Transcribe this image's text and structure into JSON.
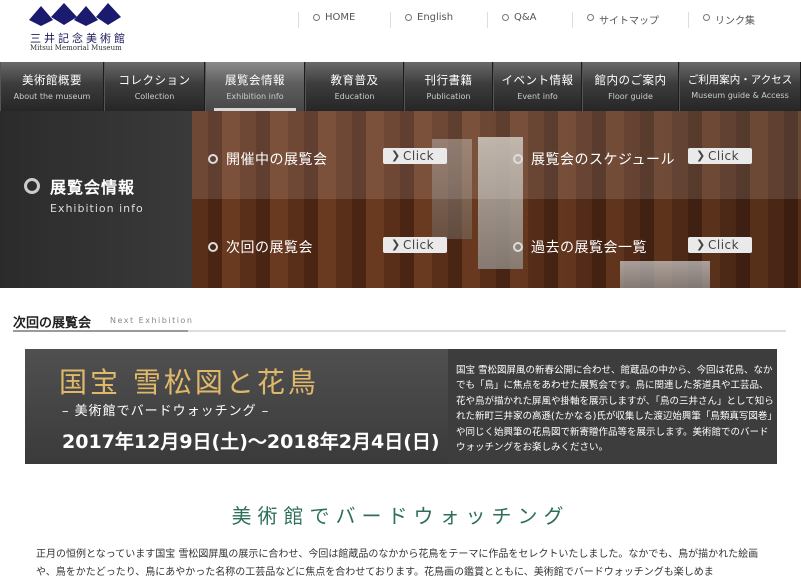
{
  "header": {
    "logo_jp": "三井記念美術館",
    "logo_en": "Mitsui Memorial Museum",
    "utility_links": [
      {
        "label": "HOME"
      },
      {
        "label": "English"
      },
      {
        "label": "Q&A"
      },
      {
        "label": "サイトマップ"
      },
      {
        "label": "リンク集"
      }
    ]
  },
  "nav": {
    "items": [
      {
        "jp": "美術館概要",
        "en": "About the museum"
      },
      {
        "jp": "コレクション",
        "en": "Collection"
      },
      {
        "jp": "展覧会情報",
        "en": "Exhibition info"
      },
      {
        "jp": "教育普及",
        "en": "Education"
      },
      {
        "jp": "刊行書籍",
        "en": "Publication"
      },
      {
        "jp": "イベント情報",
        "en": "Event info"
      },
      {
        "jp": "館内のご案内",
        "en": "Floor guide"
      },
      {
        "jp": "ご利用案内・アクセス",
        "en": "Museum guide & Access"
      }
    ],
    "active_index": 2
  },
  "hero": {
    "title_jp": "展覧会情報",
    "title_en": "Exhibition info",
    "links": [
      {
        "label": "開催中の展覧会",
        "button": "Click"
      },
      {
        "label": "展覧会のスケジュール",
        "button": "Click"
      },
      {
        "label": "次回の展覧会",
        "button": "Click"
      },
      {
        "label": "過去の展覧会一覧",
        "button": "Click"
      }
    ]
  },
  "section": {
    "title": "次回の展覧会",
    "title_en": "Next Exhibition"
  },
  "banner": {
    "title": "国宝 雪松図と花鳥",
    "subtitle": "– 美術館でバードウォッチング –",
    "dates": "2017年12月9日(土)～2018年2月4日(日)",
    "description": "国宝 雪松図屏風の新春公開に合わせ、館蔵品の中から、今回は花鳥、なかでも「鳥」に焦点をあわせた展覧会です。鳥に関連した茶道具や工芸品、花や鳥が描かれた屏風や掛軸を展示しますが、「鳥の三井さん」として知られた新町三井家の高遜(たかなる)氏が収集した渡辺始興筆「鳥類真写図巻」や同じく始興筆の花鳥図で新寄贈作品等を展示します。美術館でのバードウォッチングをお楽しみください。"
  },
  "article": {
    "heading": "美術館でバードウォッチング",
    "body": "正月の恒例となっています国宝 雪松図屏風の展示に合わせ、今回は館蔵品のなかから花鳥をテーマに作品をセレクトいたしました。なかでも、鳥が描かれた絵画や、鳥をかたどったり、鳥にあやかった名称の工芸品などに焦点を合わせております。花鳥画の鑑賞とともに、美術館でバードウォッチングも楽しめま"
  }
}
